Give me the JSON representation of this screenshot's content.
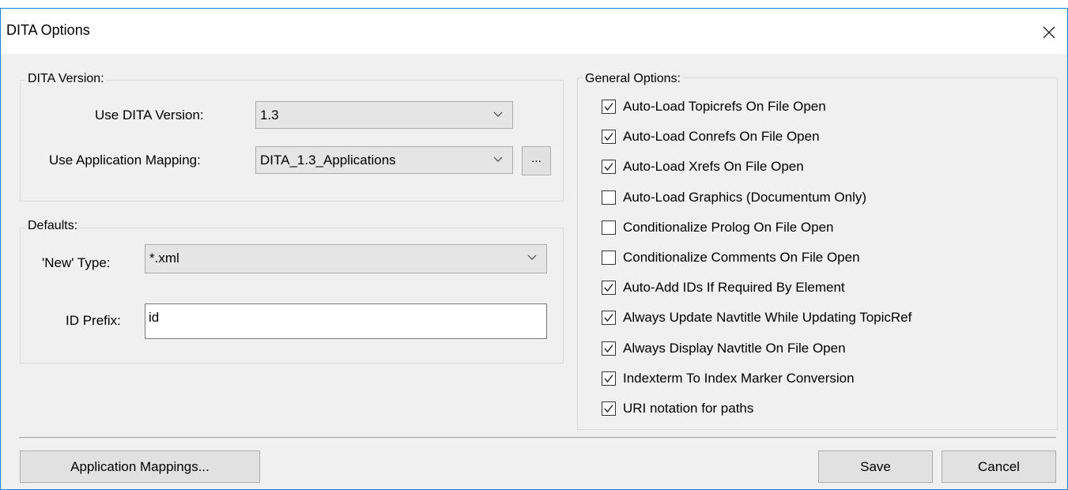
{
  "window": {
    "title": "DITA Options",
    "close_glyph": "✕"
  },
  "dita_version": {
    "group_label": "DITA Version:",
    "version_label": "Use DITA Version:",
    "version_value": "1.3",
    "mapping_label": "Use Application Mapping:",
    "mapping_value": "DITA_1.3_Applications",
    "browse_label": "..."
  },
  "defaults": {
    "group_label": "Defaults:",
    "new_type_label": "'New' Type:",
    "new_type_value": "*.xml",
    "id_prefix_label": "ID Prefix:",
    "id_prefix_value": "id"
  },
  "general_options": {
    "group_label": "General Options:",
    "options": [
      {
        "label": "Auto-Load Topicrefs On File Open",
        "checked": true
      },
      {
        "label": "Auto-Load Conrefs On File Open",
        "checked": true
      },
      {
        "label": "Auto-Load Xrefs On File Open",
        "checked": true
      },
      {
        "label": "Auto-Load Graphics (Documentum Only)",
        "checked": false
      },
      {
        "label": "Conditionalize Prolog On File Open",
        "checked": false
      },
      {
        "label": "Conditionalize Comments On File Open",
        "checked": false
      },
      {
        "label": "Auto-Add IDs If Required By Element",
        "checked": true
      },
      {
        "label": "Always Update Navtitle While Updating TopicRef",
        "checked": true
      },
      {
        "label": "Always Display Navtitle On File Open",
        "checked": true
      },
      {
        "label": "Indexterm To Index Marker Conversion",
        "checked": true
      },
      {
        "label": "URI notation for paths",
        "checked": true
      }
    ]
  },
  "buttons": {
    "app_mappings": "Application Mappings...",
    "save": "Save",
    "cancel": "Cancel"
  }
}
